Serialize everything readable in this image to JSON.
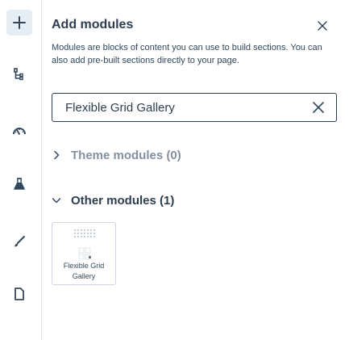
{
  "rail": {
    "items": [
      {
        "icon": "plus-icon",
        "active": true
      },
      {
        "icon": "tree-structure-icon"
      },
      {
        "icon": "speedometer-icon"
      },
      {
        "icon": "flask-icon"
      },
      {
        "icon": "brush-icon"
      },
      {
        "icon": "page-icon"
      }
    ]
  },
  "panel": {
    "title": "Add modules",
    "description": "Modules are blocks of content you can use to build sections. You can also add pre-built sections directly to your page.",
    "search": {
      "value": "Flexible Grid Gallery"
    },
    "sections": {
      "theme_label": "Theme modules (0)",
      "other_label": "Other modules (1)"
    },
    "modules": [
      {
        "name": "Flexible Grid Gallery"
      }
    ]
  },
  "colors": {
    "primary_text": "#2d3e50",
    "muted_text": "#8391a0",
    "border": "#cbd6e2",
    "active_bg": "#e6eef5"
  }
}
